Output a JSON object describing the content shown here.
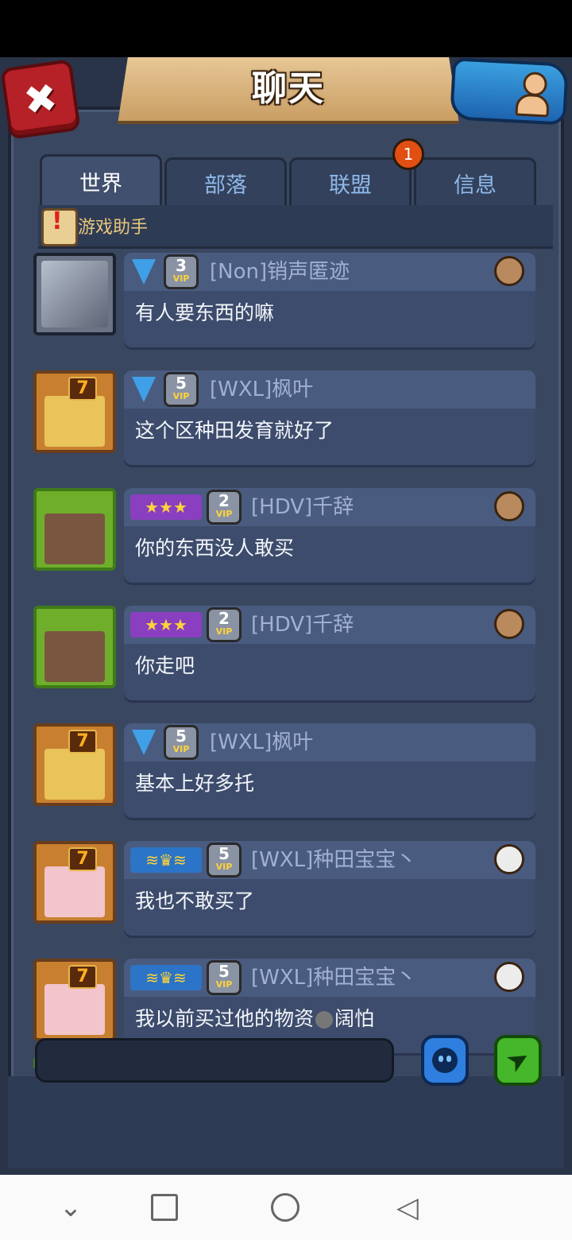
{
  "header": {
    "title": "聊天"
  },
  "tabs": [
    {
      "label": "世界",
      "active": true
    },
    {
      "label": "部落",
      "active": false
    },
    {
      "label": "联盟",
      "active": false,
      "badge": "1"
    },
    {
      "label": "信息",
      "active": false
    }
  ],
  "assistant": {
    "label": "游戏助手"
  },
  "messages": [
    {
      "sender": "[Non]销声匿迹",
      "vip": "3",
      "vip_label": "VIP",
      "text": "有人要东西的嘛",
      "rank": "shield",
      "avatar": "photo",
      "clan": "warrior"
    },
    {
      "sender": "[WXL]枫叶",
      "vip": "5",
      "vip_label": "VIP",
      "text": "这个区种田发育就好了",
      "rank": "shield",
      "avatar": "blonde",
      "level": "7"
    },
    {
      "sender": "[HDV]千辞",
      "vip": "2",
      "vip_label": "VIP",
      "text": "你的东西没人敢买",
      "rank": "stars",
      "avatar": "longhair",
      "clan": "warrior"
    },
    {
      "sender": "[HDV]千辞",
      "vip": "2",
      "vip_label": "VIP",
      "text": "你走吧",
      "rank": "stars",
      "avatar": "longhair",
      "clan": "warrior"
    },
    {
      "sender": "[WXL]枫叶",
      "vip": "5",
      "vip_label": "VIP",
      "text": "基本上好多托",
      "rank": "shield",
      "avatar": "blonde",
      "level": "7"
    },
    {
      "sender": "[WXL]种田宝宝丶",
      "vip": "5",
      "vip_label": "VIP",
      "text": "我也不敢买了",
      "rank": "wings",
      "avatar": "pink",
      "level": "7",
      "clan": "crossed"
    },
    {
      "sender": "[WXL]种田宝宝丶",
      "vip": "5",
      "vip_label": "VIP",
      "text": "我以前买过他的物资",
      "text_after": "阔怕",
      "rank": "wings",
      "avatar": "pink",
      "level": "7",
      "clan": "crossed"
    }
  ],
  "rank_glyphs": {
    "stars": "★★★",
    "wings": "≋♛≋"
  },
  "input": {
    "placeholder": ""
  },
  "icons": {
    "close": "close-icon",
    "friends": "friends-icon",
    "emoji": "emoji-icon",
    "send": "send-icon"
  },
  "colors": {
    "panel": "#2a3449",
    "bubble": "#3d4c6c",
    "sender": "#9fb1d4",
    "assistant": "#e8c77a",
    "badge": "#e14f13"
  }
}
